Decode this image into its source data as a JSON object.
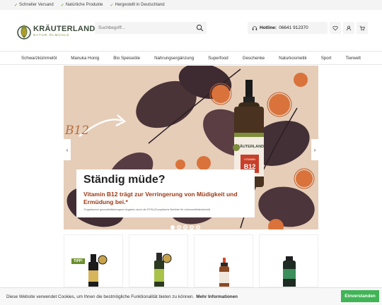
{
  "topbar": {
    "usps": [
      {
        "label": "Schneller Versand"
      },
      {
        "label": "Natürliche Produkte"
      },
      {
        "label": "Hergestellt in Deutschland"
      }
    ]
  },
  "brand": {
    "name": "KRÄUTERLAND",
    "tagline": "NATUR-ÖLMÜHLE",
    "color_primary": "#3b4a3a",
    "color_accent": "#7d8d3a"
  },
  "search": {
    "placeholder": "Suchbegriff..."
  },
  "hotline": {
    "label": "Hotline:",
    "number": "06641 912370"
  },
  "header_icons": [
    "heart-icon",
    "user-icon",
    "cart-icon"
  ],
  "nav": {
    "items": [
      {
        "label": "Schwarzkümmelöl"
      },
      {
        "label": "Manuka Honig"
      },
      {
        "label": "Bio Speiseöle"
      },
      {
        "label": "Nahrungsergänzung"
      },
      {
        "label": "Superfood"
      },
      {
        "label": "Geschenke"
      },
      {
        "label": "Naturkosmetik"
      },
      {
        "label": "Sport"
      },
      {
        "label": "Tierwelt"
      }
    ]
  },
  "hero": {
    "badge_text": "B12",
    "bottle_brand": "KRÄUTERLAND",
    "bottle_label": "VITAMIN",
    "bottle_big": "B12",
    "title": "Ständig müde?",
    "subtitle": "Vitamin B12 trägt zur Verringerung von Müdigkeit und Ermüdung bei.*",
    "note": "*Zugelassene gesundheitsbezogene Angaben durch die EFSA (Europäische Behörde für Lebensmittelsicherheit)",
    "slide_count": 5,
    "active_slide": 1
  },
  "products": {
    "tipp_label": "TIPP!"
  },
  "cookie": {
    "text": "Diese Website verwendet Cookies, um Ihnen die bestmögliche Funktionalität bieten zu können.",
    "more": "Mehr Informationen",
    "accept": "Einverstanden",
    "accept_color": "#41b457"
  }
}
